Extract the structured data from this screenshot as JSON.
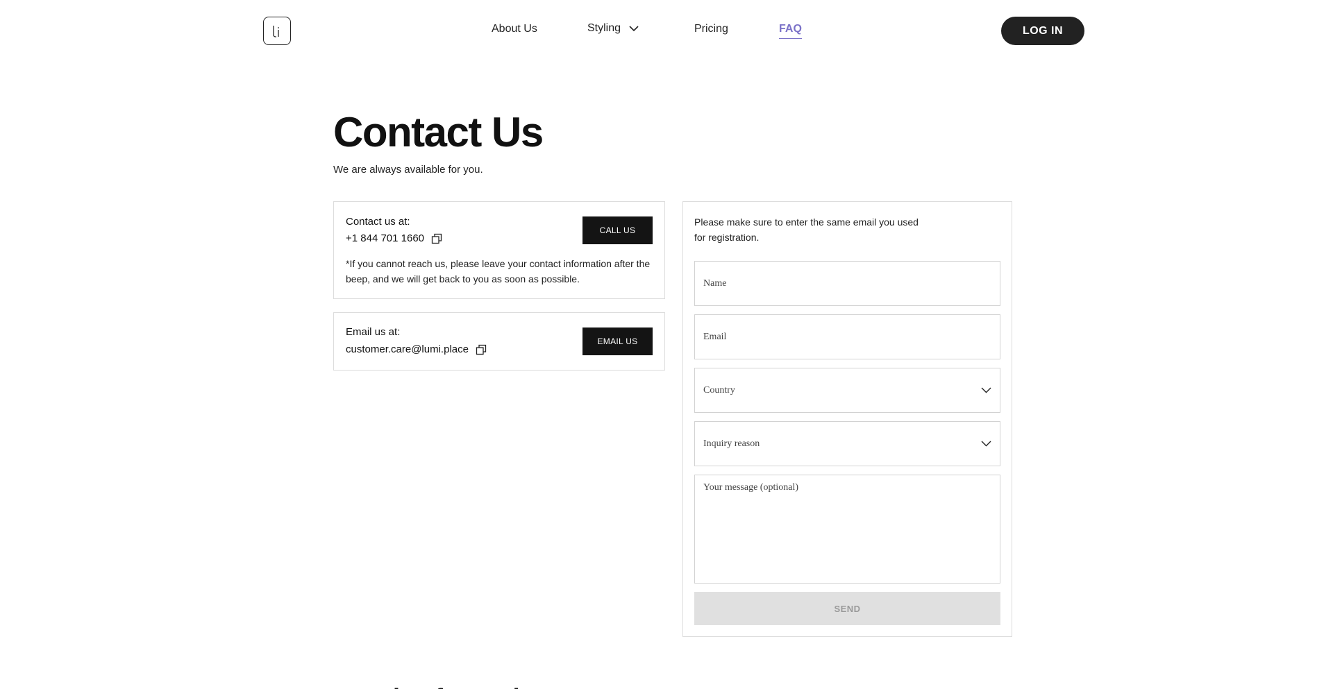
{
  "header": {
    "logo_icon": "lumi-logo-icon",
    "nav": [
      {
        "label": "About Us"
      },
      {
        "label": "Styling"
      },
      {
        "label": "Pricing"
      },
      {
        "label": "FAQ"
      }
    ],
    "active_nav": "FAQ",
    "active_color": "#7b72c8",
    "login_label": "LOG IN"
  },
  "page": {
    "title": "Contact Us",
    "subtitle": "We are always available for you."
  },
  "phone_card": {
    "label": "Contact us at:",
    "value": "+1 844 701 1660",
    "button": "CALL US",
    "note": "*If you cannot reach us, please leave your contact information after the beep, and we will get back to you as soon as possible."
  },
  "email_card": {
    "label": "Email us at:",
    "value": "customer.care@lumi.place",
    "button": "EMAIL US"
  },
  "form": {
    "note": "Please make sure to enter the same email you used for registration.",
    "name_placeholder": "Name",
    "email_placeholder": "Email",
    "country_placeholder": "Country",
    "reason_placeholder": "Inquiry reason",
    "message_placeholder": "Your message (optional)",
    "send_label": "SEND"
  },
  "faq": {
    "heading": "People often ask"
  }
}
